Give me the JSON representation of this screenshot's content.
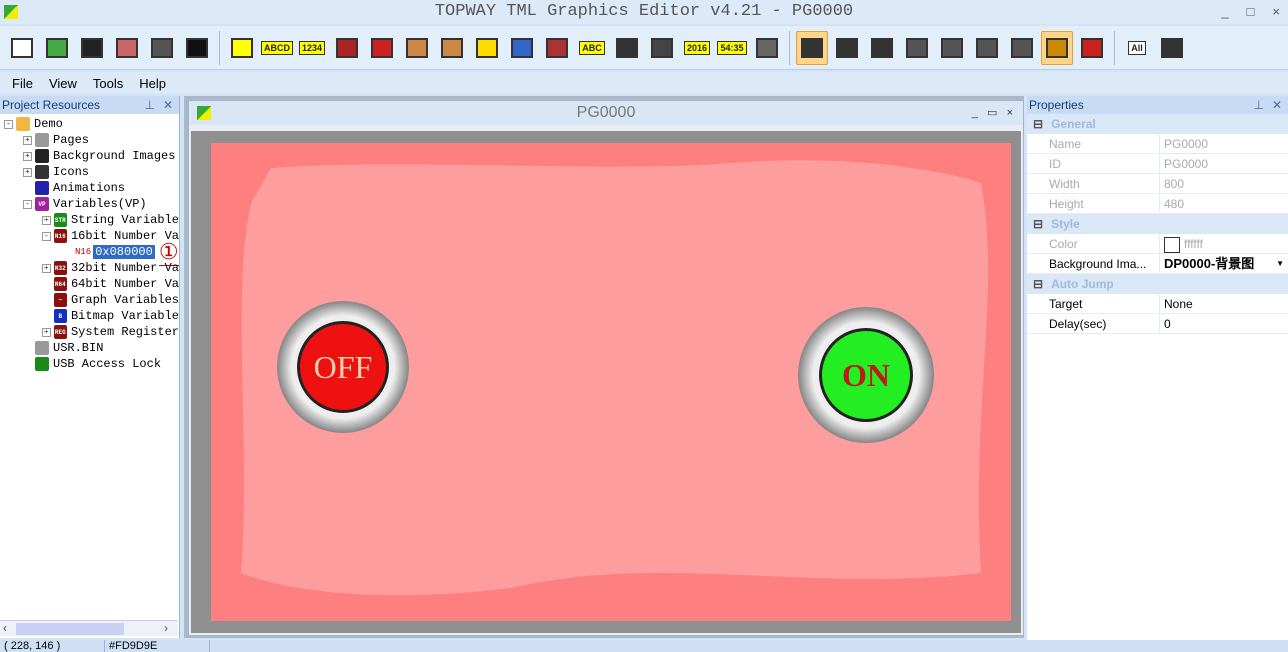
{
  "title": "TOPWAY TML Graphics Editor v4.21 - PG0000",
  "window_controls": [
    "_",
    "□",
    "×"
  ],
  "toolbar": {
    "icons": [
      "new-icon",
      "open-icon",
      "save-icon",
      "export-icon",
      "settings-icon",
      "font-icon",
      "rectangle-icon",
      "text-abcd-icon",
      "number-1234-icon",
      "bar-icon",
      "record-icon",
      "icon-icon",
      "animation-icon",
      "graph-icon",
      "bitmap-icon",
      "qrcode-icon",
      "string-abc-icon",
      "touch-icon",
      "video-icon",
      "date-icon",
      "time-icon",
      "region-icon",
      "pointer-icon",
      "copy-icon",
      "paste-icon",
      "align-left-icon",
      "align-right-icon",
      "align-top-icon",
      "align-bottom-icon",
      "preview-icon",
      "hide-icon",
      "all-icon",
      "more-icon"
    ],
    "labels": {
      "text": "ABCD",
      "number": "1234",
      "string": "ABC",
      "date": "2016",
      "time": "54:35",
      "all": "All"
    }
  },
  "menu": [
    "File",
    "View",
    "Tools",
    "Help"
  ],
  "left_panel": {
    "title": "Project Resources",
    "tree": [
      {
        "label": "Demo",
        "level": 0,
        "exp": "-",
        "icon": "folder",
        "color": "#f0b840"
      },
      {
        "label": "Pages",
        "level": 1,
        "exp": "+",
        "icon": "",
        "color": "#999"
      },
      {
        "label": "Background Images",
        "level": 1,
        "exp": "+",
        "icon": "",
        "color": "#222"
      },
      {
        "label": "Icons",
        "level": 1,
        "exp": "+",
        "icon": "",
        "color": "#333"
      },
      {
        "label": "Animations",
        "level": 1,
        "exp": "",
        "icon": "",
        "color": "#22a"
      },
      {
        "label": "Variables(VP)",
        "level": 1,
        "exp": "-",
        "icon": "VP",
        "color": "#a020a0"
      },
      {
        "label": "String Variable",
        "level": 2,
        "exp": "+",
        "icon": "STR",
        "color": "#1a8a1a"
      },
      {
        "label": "16bit Number Va",
        "level": 2,
        "exp": "-",
        "icon": "N16",
        "color": "#8b1010"
      },
      {
        "label": "32bit Number Va",
        "level": 2,
        "exp": "+",
        "icon": "N32",
        "color": "#8b1010"
      },
      {
        "label": "64bit Number Va",
        "level": 2,
        "exp": "",
        "icon": "N64",
        "color": "#8b1010"
      },
      {
        "label": "Graph Variables",
        "level": 2,
        "exp": "",
        "icon": "~",
        "color": "#8b1010"
      },
      {
        "label": "Bitmap Variable",
        "level": 2,
        "exp": "",
        "icon": "B",
        "color": "#1030c0"
      },
      {
        "label": "System Register",
        "level": 2,
        "exp": "+",
        "icon": "REG",
        "color": "#8b1010"
      },
      {
        "label": "USR.BIN",
        "level": 1,
        "exp": "",
        "icon": "",
        "color": "#999"
      },
      {
        "label": "USB Access Lock",
        "level": 1,
        "exp": "",
        "icon": "",
        "color": "#1a8a1a"
      }
    ],
    "selected": {
      "prefix": "N16",
      "label": "0x080000"
    },
    "annotation": "①"
  },
  "page": {
    "title": "PG0000",
    "off_label": "OFF",
    "on_label": "ON",
    "bg_color": "#FD7F80"
  },
  "properties": {
    "title": "Properties",
    "sections": [
      {
        "name": "General",
        "rows": [
          {
            "k": "Name",
            "v": "PG0000",
            "disabled": true
          },
          {
            "k": "ID",
            "v": "PG0000",
            "disabled": true
          },
          {
            "k": "Width",
            "v": "800",
            "disabled": true
          },
          {
            "k": "Height",
            "v": "480",
            "disabled": true
          }
        ]
      },
      {
        "name": "Style",
        "rows": [
          {
            "k": "Color",
            "v": "ffffff",
            "disabled": true
          },
          {
            "k": "Background Ima...",
            "v": "DP0000-背景图",
            "disabled": false
          }
        ]
      },
      {
        "name": "Auto Jump",
        "rows": [
          {
            "k": "Target",
            "v": "None",
            "disabled": false
          },
          {
            "k": "Delay(sec)",
            "v": "0",
            "disabled": false
          }
        ]
      }
    ]
  },
  "status": {
    "coords": "( 228, 146 )",
    "color": "#FD9D9E"
  }
}
